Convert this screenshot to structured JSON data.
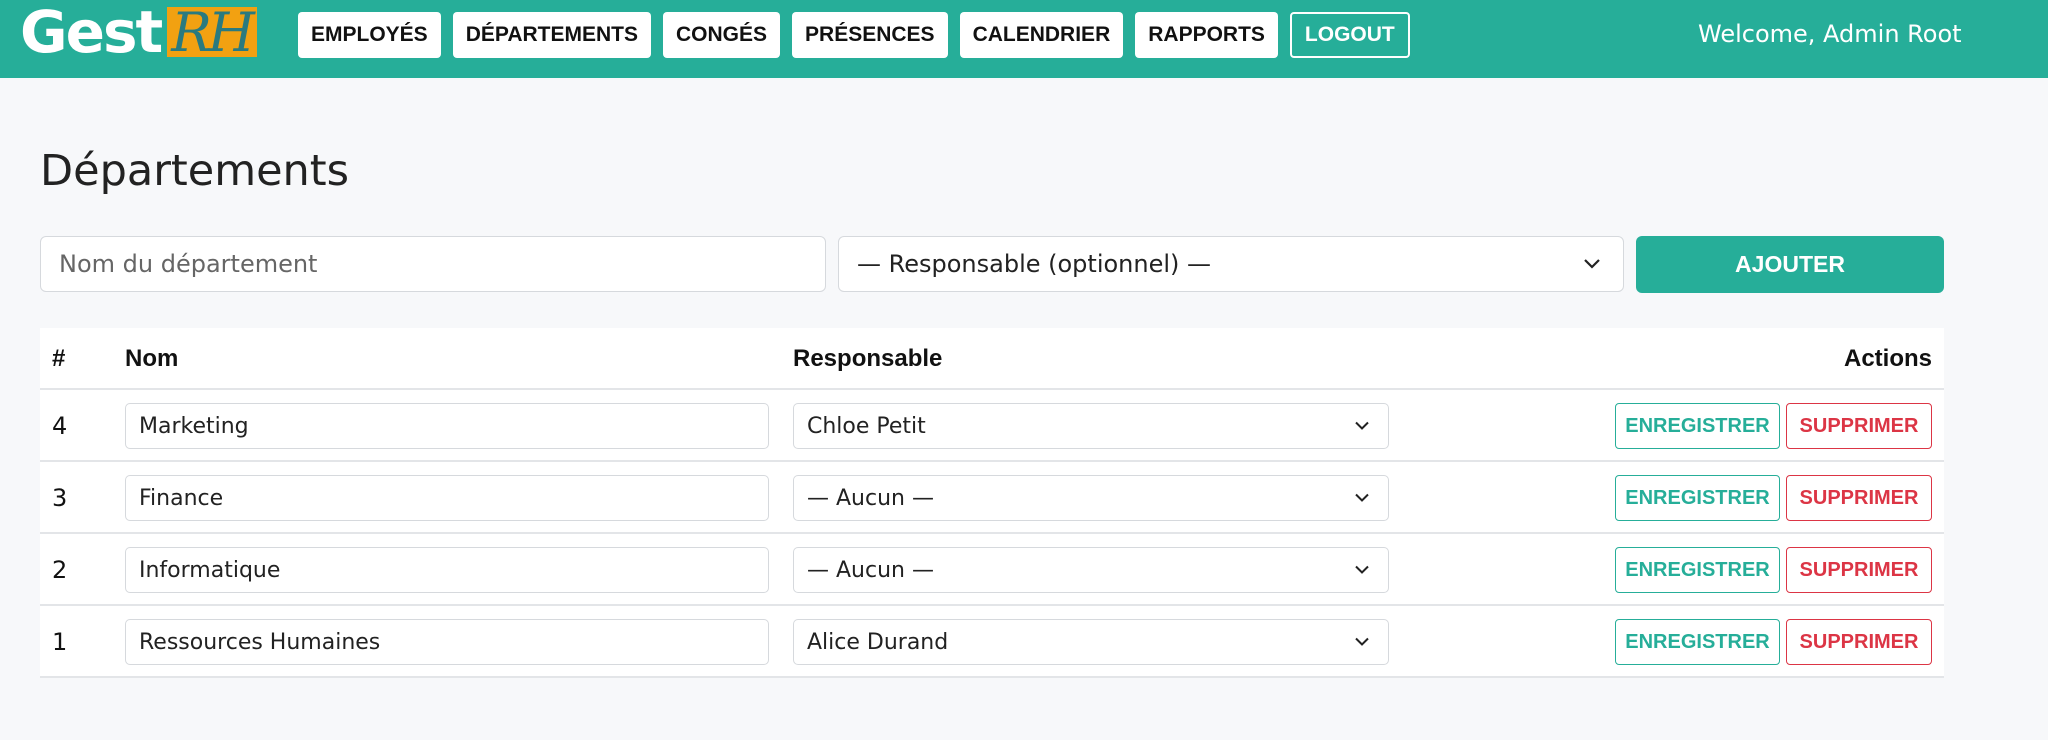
{
  "app": {
    "logo_main": "Gest",
    "logo_accent": "RH"
  },
  "nav": {
    "items": [
      "EMPLOYÉS",
      "DÉPARTEMENTS",
      "CONGÉS",
      "PRÉSENCES",
      "CALENDRIER",
      "RAPPORTS"
    ],
    "logout": "LOGOUT"
  },
  "welcome": "Welcome, Admin Root",
  "page": {
    "title": "Départements"
  },
  "form": {
    "name_placeholder": "Nom du département",
    "manager_selected": "— Responsable (optionnel) —",
    "add_label": "AJOUTER"
  },
  "table": {
    "headers": {
      "id": "#",
      "name": "Nom",
      "manager": "Responsable",
      "actions": "Actions"
    },
    "rows": [
      {
        "id": "4",
        "name": "Marketing",
        "manager": "Chloe Petit"
      },
      {
        "id": "3",
        "name": "Finance",
        "manager": "— Aucun —"
      },
      {
        "id": "2",
        "name": "Informatique",
        "manager": "— Aucun —"
      },
      {
        "id": "1",
        "name": "Ressources Humaines",
        "manager": "Alice Durand"
      }
    ],
    "save_label": "ENREGISTRER",
    "delete_label": "SUPPRIMER"
  },
  "colors": {
    "brand": "#26ae99",
    "logo_box": "#f2a111",
    "danger": "#dc3545"
  },
  "icons": {
    "select_arrow": "chevron-down-icon"
  }
}
